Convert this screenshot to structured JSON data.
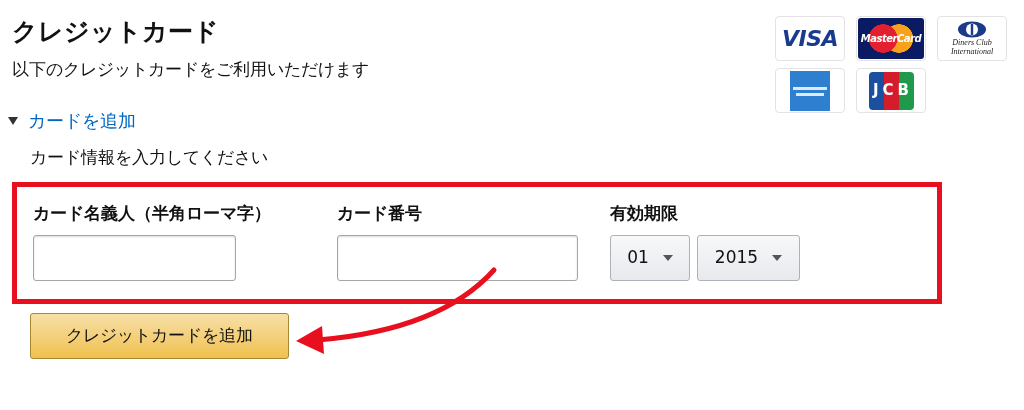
{
  "title": "クレジットカード",
  "subtitle": "以下のクレジットカードをご利用いただけます",
  "card_logos": [
    {
      "kind": "visa",
      "text": "VISA"
    },
    {
      "kind": "mastercard",
      "text": "MasterCard"
    },
    {
      "kind": "diners",
      "text": "Diners Club International"
    },
    {
      "kind": "amex"
    },
    {
      "kind": "jcb",
      "text": "JCB"
    }
  ],
  "add_card_toggle": {
    "label": "カードを追加",
    "expanded": true
  },
  "instruction": "カード情報を入力してください",
  "form": {
    "fields": [
      {
        "label": "カード名義人（半角ローマ字）",
        "kind": "text"
      },
      {
        "label": "カード番号",
        "kind": "text"
      },
      {
        "label": "有効期限",
        "kind": "expiry",
        "selects": [
          "01",
          "2015"
        ]
      }
    ]
  },
  "submit_button": "クレジットカードを追加",
  "annotation": {
    "highlight": true,
    "arrow": true
  }
}
